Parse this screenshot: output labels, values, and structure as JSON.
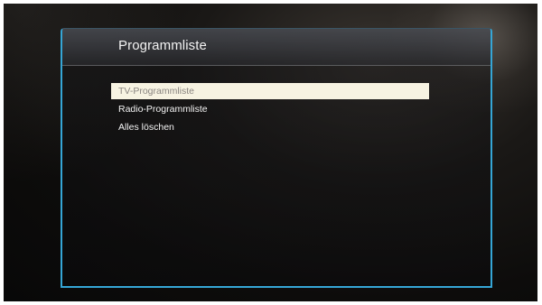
{
  "screen": {
    "title": "Programmliste",
    "accent_color": "#35a6d6",
    "selected_highlight_color": "#f7f3e2"
  },
  "menu": {
    "items": [
      {
        "label": "TV-Programmliste",
        "selected": true
      },
      {
        "label": "Radio-Programmliste",
        "selected": false
      },
      {
        "label": "Alles löschen",
        "selected": false
      }
    ]
  }
}
